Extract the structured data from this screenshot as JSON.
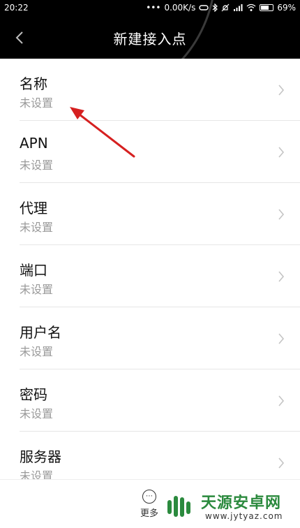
{
  "status_bar": {
    "time": "20:22",
    "dots": "•••",
    "speed": "0.00K/s",
    "battery": "69%",
    "battery_level": 0.69
  },
  "header": {
    "title": "新建接入点"
  },
  "items": [
    {
      "label": "名称",
      "value": "未设置"
    },
    {
      "label": "APN",
      "value": "未设置"
    },
    {
      "label": "代理",
      "value": "未设置"
    },
    {
      "label": "端口",
      "value": "未设置"
    },
    {
      "label": "用户名",
      "value": "未设置"
    },
    {
      "label": "密码",
      "value": "未设置"
    },
    {
      "label": "服务器",
      "value": "未设置"
    }
  ],
  "bottom_bar": {
    "more_label": "更多"
  },
  "watermark": {
    "name": "天源安卓网",
    "url": "www.jytyaz.com"
  },
  "colors": {
    "header_bg": "#000000",
    "annotation_arrow": "#d62020",
    "watermark_green": "#2b8a3e"
  }
}
